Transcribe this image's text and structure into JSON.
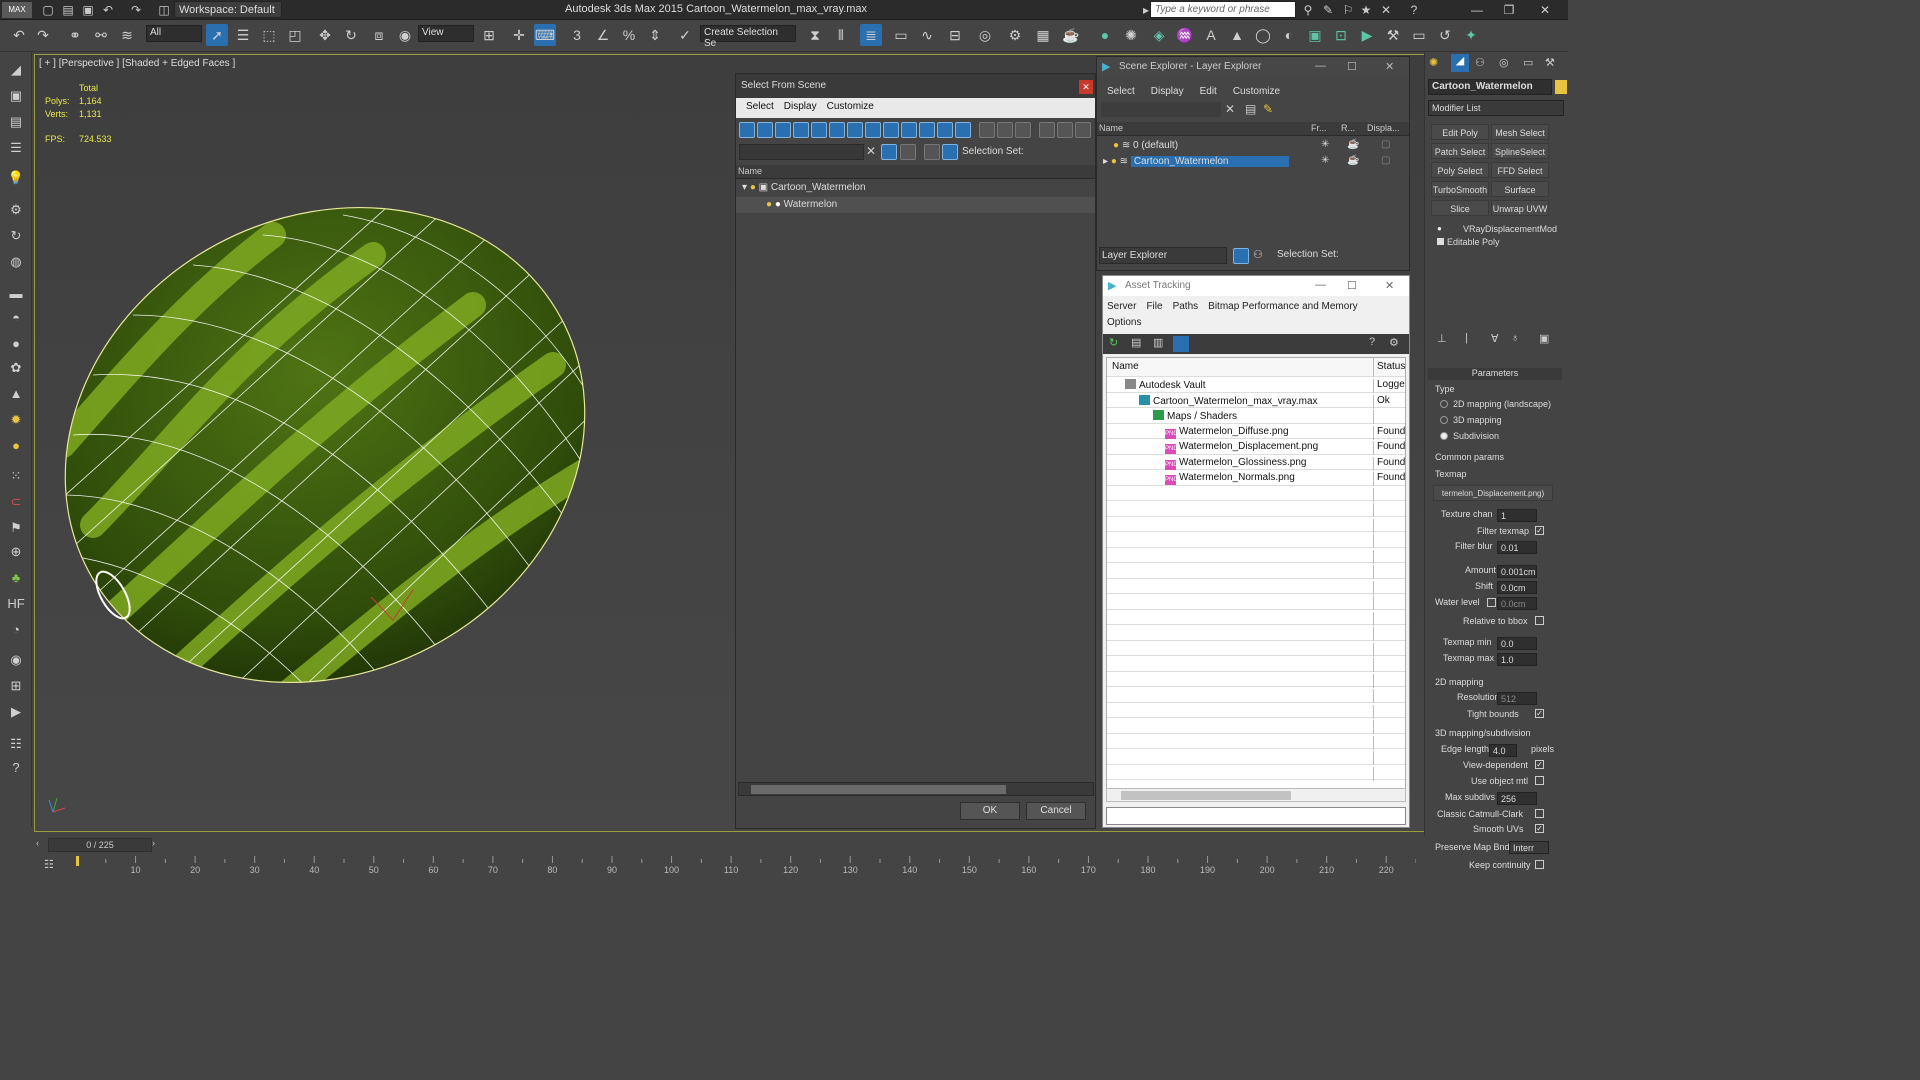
{
  "app": {
    "title": "Autodesk 3ds Max  2015    Cartoon_Watermelon_max_vray.max",
    "workspace": "Workspace: Default",
    "search_placeholder": "Type a keyword or phrase"
  },
  "toolbar": {
    "filter": "All",
    "view": "View",
    "selection_set": "Create Selection Se"
  },
  "viewport": {
    "label": "[ + ] [Perspective ] [Shaded + Edged Faces ]",
    "stats": {
      "total_label": "Total",
      "polys_label": "Polys:",
      "polys": "1,164",
      "verts_label": "Verts:",
      "verts": "1,131",
      "fps_label": "FPS:",
      "fps": "724.533"
    }
  },
  "select_from_scene": {
    "title": "Select From Scene",
    "menu": [
      "Select",
      "Display",
      "Customize"
    ],
    "selection_set_label": "Selection Set:",
    "column_name": "Name",
    "items": [
      "Cartoon_Watermelon",
      "Watermelon"
    ],
    "ok": "OK",
    "cancel": "Cancel"
  },
  "scene_explorer": {
    "title": "Scene Explorer - Layer Explorer",
    "menu": [
      "Select",
      "Display",
      "Edit",
      "Customize"
    ],
    "columns": [
      "Name",
      "Fr...",
      "R...",
      "Displa..."
    ],
    "layers": [
      "0 (default)",
      "Cartoon_Watermelon"
    ],
    "footer_dropdown": "Layer Explorer",
    "selection_set_label": "Selection Set:"
  },
  "asset_tracking": {
    "title": "Asset Tracking",
    "menu": [
      "Server",
      "File",
      "Paths",
      "Bitmap Performance and Memory"
    ],
    "menu2": [
      "Options"
    ],
    "columns": [
      "Name",
      "Status"
    ],
    "rows": [
      {
        "name": "Autodesk Vault",
        "status": "Logged"
      },
      {
        "name": "Cartoon_Watermelon_max_vray.max",
        "status": "Ok"
      },
      {
        "name": "Maps / Shaders",
        "status": ""
      },
      {
        "name": "Watermelon_Diffuse.png",
        "status": "Found"
      },
      {
        "name": "Watermelon_Displacement.png",
        "status": "Found"
      },
      {
        "name": "Watermelon_Glossiness.png",
        "status": "Found"
      },
      {
        "name": "Watermelon_Normals.png",
        "status": "Found"
      }
    ]
  },
  "command_panel": {
    "object_name": "Cartoon_Watermelon",
    "modifier_list": "Modifier List",
    "buttons": [
      "Edit Poly",
      "Mesh Select",
      "Patch Select",
      "SplineSelect",
      "Poly Select",
      "FFD Select",
      "TurboSmooth",
      "Surface Select",
      "Slice",
      "Unwrap UVW"
    ],
    "stack": [
      "VRayDisplacementMod",
      "Editable Poly"
    ],
    "rollout": "Parameters",
    "type_label": "Type",
    "type_options": [
      "2D mapping (landscape)",
      "3D mapping",
      "Subdivision"
    ],
    "common_params": "Common params",
    "texmap_label": "Texmap",
    "texmap_value": "termelon_Displacement.png)",
    "texture_chan_label": "Texture chan",
    "texture_chan": "1",
    "filter_texmap_label": "Filter texmap",
    "filter_blur_label": "Filter blur",
    "filter_blur": "0.01",
    "amount_label": "Amount",
    "amount": "0.001cm",
    "shift_label": "Shift",
    "shift": "0.0cm",
    "water_level_label": "Water level",
    "water_level": "0.0cm",
    "relative_bbox_label": "Relative to bbox",
    "texmap_min_label": "Texmap min",
    "texmap_min": "0.0",
    "texmap_max_label": "Texmap max",
    "texmap_max": "1.0",
    "mapping_2d": "2D mapping",
    "resolution_label": "Resolution",
    "resolution": "512",
    "tight_bounds_label": "Tight bounds",
    "mapping_3d": "3D mapping/subdivision",
    "edge_length_label": "Edge length",
    "edge_length": "4.0",
    "pixels_label": "pixels",
    "view_dependent_label": "View-dependent",
    "use_object_mtl_label": "Use object mtl",
    "max_subdivs_label": "Max subdivs",
    "max_subdivs": "256",
    "classic_catmull_label": "Classic Catmull-Clark",
    "smooth_uvs_label": "Smooth UVs",
    "preserve_map_label": "Preserve Map Bnd",
    "preserve_map": "Interr",
    "keep_continuity_label": "Keep continuity"
  },
  "timeline": {
    "frame": "0 / 225",
    "ticks": [
      "10",
      "20",
      "30",
      "40",
      "50",
      "60",
      "70",
      "80",
      "90",
      "100",
      "110",
      "120",
      "130",
      "140",
      "150",
      "160",
      "170",
      "180",
      "190",
      "200",
      "210",
      "220"
    ]
  }
}
